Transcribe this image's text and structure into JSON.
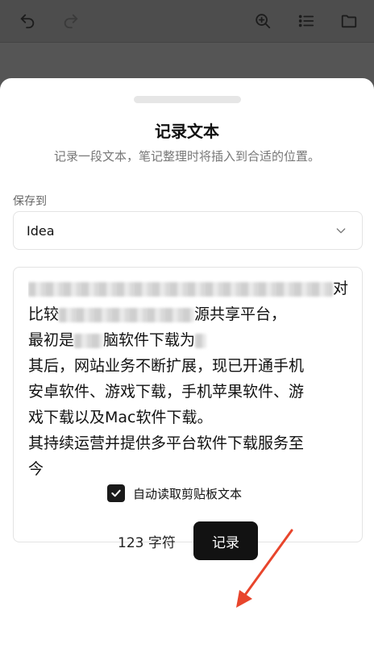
{
  "toolbar": {
    "icons": [
      "undo-icon",
      "redo-icon",
      "zoom-in-icon",
      "list-icon",
      "folder-icon"
    ]
  },
  "sheet": {
    "title": "记录文本",
    "subtitle": "记录一段文本，笔记整理时将插入到合适的位置。",
    "save_to_label": "保存到",
    "save_to_value": "Idea",
    "text_lines": [
      "对",
      "比较",
      "最初是",
      "其后，网站业务不断扩展，现已开通手机",
      "安卓软件、游戏下载，手机苹果软件、游",
      "戏下载以及Mac软件下载。",
      "其持续运营并提供多平台软件下载服务至",
      "今"
    ],
    "text_line2_tail": "源共享平台，",
    "text_line3_tail": "脑软件下载为",
    "auto_read_label": "自动读取剪贴板文本",
    "auto_read_checked": true,
    "char_count": "123 字符",
    "record_label": "记录"
  },
  "colors": {
    "overlay": "#555555",
    "sheet_bg": "#ffffff",
    "button_bg": "#121212",
    "arrow": "#e8452c"
  }
}
